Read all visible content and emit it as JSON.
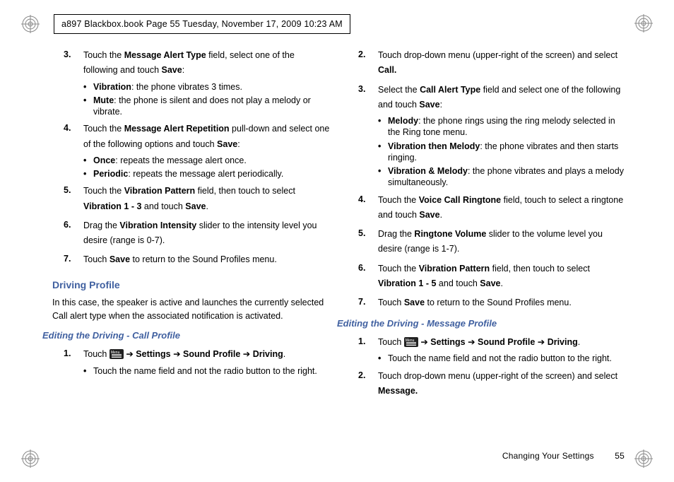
{
  "header": {
    "stamp": "a897 Blackbox.book  Page 55  Tuesday, November 17, 2009  10:23 AM"
  },
  "left": {
    "items": [
      {
        "n": "3.",
        "runs": [
          {
            "t": "Touch the "
          },
          {
            "t": "Message Alert Type",
            "b": true
          },
          {
            "t": " field, select one of the following and touch "
          },
          {
            "t": "Save",
            "b": true
          },
          {
            "t": ":"
          }
        ],
        "bullets": [
          [
            {
              "t": "Vibration",
              "b": true
            },
            {
              "t": ": the phone vibrates 3 times."
            }
          ],
          [
            {
              "t": "Mute",
              "b": true
            },
            {
              "t": ": the phone is silent and does not play a melody or vibrate."
            }
          ]
        ]
      },
      {
        "n": "4.",
        "runs": [
          {
            "t": "Touch the "
          },
          {
            "t": "Message Alert Repetition",
            "b": true
          },
          {
            "t": " pull-down and select one of the following options and touch "
          },
          {
            "t": "Save",
            "b": true
          },
          {
            "t": ":"
          }
        ],
        "bullets": [
          [
            {
              "t": "Once",
              "b": true
            },
            {
              "t": ": repeats the message alert once."
            }
          ],
          [
            {
              "t": "Periodic",
              "b": true
            },
            {
              "t": ": repeats the message alert periodically."
            }
          ]
        ]
      },
      {
        "n": "5.",
        "runs": [
          {
            "t": "Touch the "
          },
          {
            "t": "Vibration Pattern",
            "b": true
          },
          {
            "t": " field, then touch to select "
          },
          {
            "t": "Vibration 1 - 3",
            "b": true
          },
          {
            "t": " and touch "
          },
          {
            "t": "Save",
            "b": true
          },
          {
            "t": "."
          }
        ]
      },
      {
        "n": "6.",
        "runs": [
          {
            "t": "Drag the "
          },
          {
            "t": "Vibration Intensity",
            "b": true
          },
          {
            "t": " slider to the intensity level you desire (range is 0-7)."
          }
        ]
      },
      {
        "n": "7.",
        "runs": [
          {
            "t": "Touch "
          },
          {
            "t": "Save",
            "b": true
          },
          {
            "t": " to return to the Sound Profiles menu."
          }
        ]
      }
    ],
    "h2": "Driving Profile",
    "intro": "In this case, the speaker is active and launches the currently selected Call alert type when the associated notification is activated.",
    "h3": "Editing the Driving - Call Profile",
    "sub_items": [
      {
        "n": "1.",
        "runs": [
          {
            "t": "Touch  "
          },
          {
            "icon": true
          },
          {
            "t": "  "
          },
          {
            "t": "➔ ",
            "cls": "arrow"
          },
          {
            "t": "Settings",
            "b": true
          },
          {
            "t": " ➔ "
          },
          {
            "t": "Sound Profile",
            "b": true
          },
          {
            "t": " ➔ "
          },
          {
            "t": "Driving",
            "b": true
          },
          {
            "t": "."
          }
        ],
        "bullets": [
          [
            {
              "t": "Touch the name field and not the radio button to the right."
            }
          ]
        ]
      }
    ]
  },
  "right": {
    "items": [
      {
        "n": "2.",
        "runs": [
          {
            "t": "Touch drop-down menu (upper-right of the screen) and select "
          },
          {
            "t": "Call.",
            "b": true
          }
        ]
      },
      {
        "n": "3.",
        "runs": [
          {
            "t": "Select the "
          },
          {
            "t": "Call Alert Type",
            "b": true
          },
          {
            "t": " field and select one of the following and touch "
          },
          {
            "t": "Save",
            "b": true
          },
          {
            "t": ":"
          }
        ],
        "bullets": [
          [
            {
              "t": "Melody",
              "b": true
            },
            {
              "t": ": the phone rings using the ring melody selected in the Ring tone menu."
            }
          ],
          [
            {
              "t": "Vibration then Melody",
              "b": true
            },
            {
              "t": ": the phone vibrates and then starts ringing."
            }
          ],
          [
            {
              "t": "Vibration & Melody",
              "b": true
            },
            {
              "t": ": the phone vibrates and plays a melody simultaneously."
            }
          ]
        ]
      },
      {
        "n": "4.",
        "runs": [
          {
            "t": "Touch the "
          },
          {
            "t": "Voice Call Ringtone",
            "b": true
          },
          {
            "t": " field, touch to select a ringtone and touch "
          },
          {
            "t": "Save",
            "b": true
          },
          {
            "t": "."
          }
        ]
      },
      {
        "n": "5.",
        "runs": [
          {
            "t": "Drag the "
          },
          {
            "t": "Ringtone Volume",
            "b": true
          },
          {
            "t": " slider to the volume level you desire (range is 1-7)."
          }
        ]
      },
      {
        "n": "6.",
        "runs": [
          {
            "t": "Touch the "
          },
          {
            "t": "Vibration Pattern",
            "b": true
          },
          {
            "t": " field, then touch to select "
          },
          {
            "t": "Vibration 1 - 5",
            "b": true
          },
          {
            "t": " and touch "
          },
          {
            "t": "Save",
            "b": true
          },
          {
            "t": "."
          }
        ]
      },
      {
        "n": "7.",
        "runs": [
          {
            "t": "Touch "
          },
          {
            "t": "Save",
            "b": true
          },
          {
            "t": " to return to the Sound Profiles menu."
          }
        ]
      }
    ],
    "h3": "Editing the Driving - Message Profile",
    "sub_items": [
      {
        "n": "1.",
        "runs": [
          {
            "t": "Touch  "
          },
          {
            "icon": true
          },
          {
            "t": "  "
          },
          {
            "t": "➔ ",
            "cls": "arrow"
          },
          {
            "t": "Settings",
            "b": true
          },
          {
            "t": " ➔ "
          },
          {
            "t": "Sound Profile",
            "b": true
          },
          {
            "t": " ➔ "
          },
          {
            "t": "Driving",
            "b": true
          },
          {
            "t": "."
          }
        ],
        "bullets": [
          [
            {
              "t": "Touch the name field and not the radio button to the right."
            }
          ]
        ]
      },
      {
        "n": "2.",
        "runs": [
          {
            "t": "Touch drop-down menu (upper-right of the screen) and select "
          },
          {
            "t": "Message.",
            "b": true
          }
        ]
      }
    ]
  },
  "footer": {
    "section": "Changing Your Settings",
    "page": "55"
  }
}
